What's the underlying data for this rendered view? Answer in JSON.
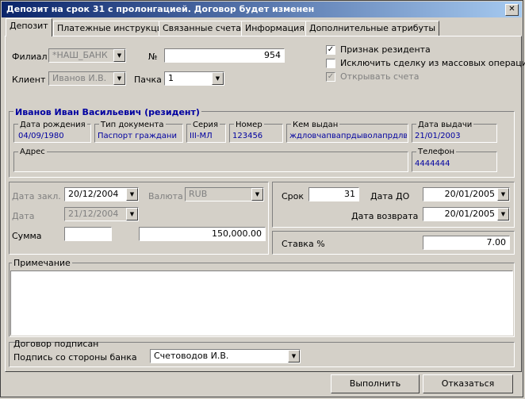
{
  "window": {
    "title": "Депозит на срок 31 с  пролонгацией. Договор будет изменен",
    "close_glyph": "✕"
  },
  "tabs": [
    "Депозит",
    "Платежные инструкции",
    "Связанные счета",
    "Информация",
    "Дополнительные атрибуты"
  ],
  "top": {
    "filial_label": "Филиал",
    "filial_value": "*НАШ_БАНК",
    "number_label": "№",
    "number_value": "954",
    "client_label": "Клиент",
    "client_value": "Иванов И.В.",
    "pack_label": "Пачка",
    "pack_value": "1"
  },
  "checks": {
    "resident_label": "Признак резидента",
    "resident_checked": true,
    "exclude_label": "Исключить сделку из массовых операций",
    "exclude_checked": false,
    "open_account_label": "Открывать счета",
    "open_account_checked": true
  },
  "client_info": {
    "name": "Иванов Иван Васильевич (резидент)",
    "birth_label": "Дата рождения",
    "birth_value": "04/09/1980",
    "doc_label": "Тип документа",
    "doc_value": "Паспорт граждани",
    "series_label": "Серия",
    "series_value": "III-МЛ",
    "number_label": "Номер",
    "number_value": "123456",
    "issued_by_label": "Кем выдан",
    "issued_by_value": "ждловчапвапрдыволапрдлвс",
    "issue_date_label": "Дата выдачи",
    "issue_date_value": "21/01/2003",
    "address_label": "Адрес",
    "address_value": "",
    "phone_label": "Телефон",
    "phone_value": "4444444"
  },
  "deal": {
    "date_conclusion_label": "Дата закл.",
    "date_conclusion_value": "20/12/2004",
    "currency_label": "Валюта",
    "currency_value": "RUB",
    "date_label": "Дата",
    "date_value": "21/12/2004",
    "sum_label": "Сумма",
    "sum_small_value": "",
    "sum_value": "150,000.00"
  },
  "term": {
    "term_label": "Срок",
    "term_value": "31",
    "date_to_label": "Дата ДО",
    "date_to_value": "20/01/2005",
    "return_date_label": "Дата возврата",
    "return_date_value": "20/01/2005",
    "rate_label": "Ставка %",
    "rate_value": "7.00"
  },
  "note": {
    "label": "Примечание",
    "value": ""
  },
  "signed": {
    "label": "Договор подписан",
    "bank_sign_label": "Подпись со стороны банка",
    "bank_sign_value": "Счетоводов И.В."
  },
  "footer": {
    "ok_label": "Выполнить",
    "cancel_label": "Отказаться"
  },
  "icons": {
    "dropdown": "▼",
    "check": "✓"
  },
  "colors": {
    "title_start": "#0a246a",
    "title_end": "#a6caf0",
    "info_text": "#0000a0",
    "face": "#d4d0c8"
  }
}
